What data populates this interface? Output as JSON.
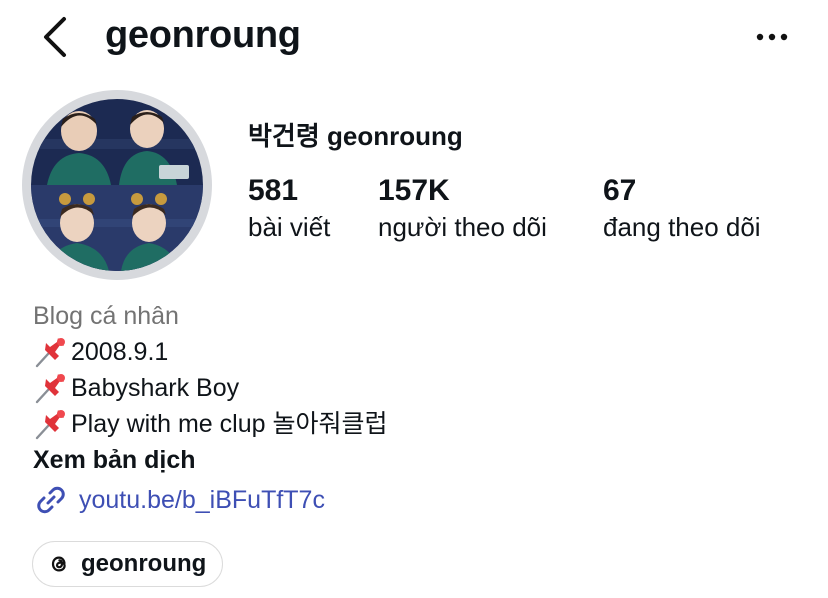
{
  "header": {
    "back_icon": "chevron-left-icon",
    "username": "geonroung",
    "more_icon": "more-horizontal-icon"
  },
  "profile": {
    "display_name": "박건령 geonroung",
    "stats": [
      {
        "value": "581",
        "label": "bài viết"
      },
      {
        "value": "157K",
        "label": "người theo dõi"
      },
      {
        "value": "67",
        "label": "đang theo dõi"
      }
    ]
  },
  "bio": {
    "category": "Blog cá nhân",
    "lines": [
      "2008.9.1",
      "Babyshark Boy",
      "Play with me clup 놀아줘클럽"
    ],
    "line_icon": "pushpin-icon",
    "see_translation": "Xem bản dịch",
    "link": "youtu.be/b_iBFuTfT7c",
    "link_icon": "link-icon"
  },
  "threads": {
    "icon": "threads-icon",
    "label": "geonroung"
  },
  "colors": {
    "link": "#3e4fb4",
    "category": "#737373",
    "avatar_ring": "#d7d9dd"
  }
}
